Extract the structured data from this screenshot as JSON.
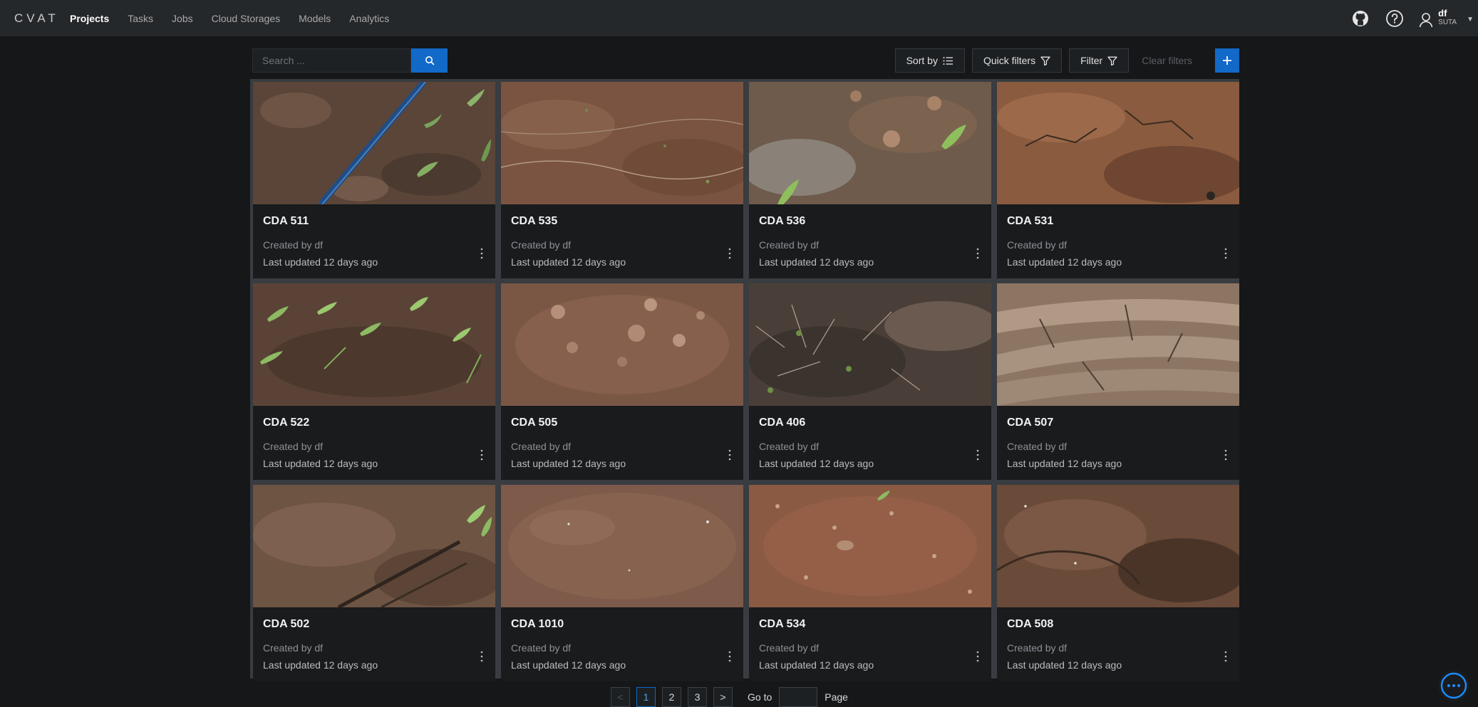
{
  "app": {
    "logo": "CVAT"
  },
  "nav": [
    {
      "label": "Projects",
      "active": true
    },
    {
      "label": "Tasks"
    },
    {
      "label": "Jobs"
    },
    {
      "label": "Cloud Storages"
    },
    {
      "label": "Models"
    },
    {
      "label": "Analytics"
    }
  ],
  "header_icons": [
    "github-icon",
    "help-icon",
    "user-icon"
  ],
  "user": {
    "name": "df",
    "org": "SUTA"
  },
  "search": {
    "placeholder": "Search ..."
  },
  "toolbar": {
    "sort_label": "Sort by",
    "quick_filters_label": "Quick filters",
    "filter_label": "Filter",
    "clear_label": "Clear filters",
    "add_label": "+"
  },
  "projects": [
    {
      "title": "CDA 511",
      "creator": "Created by df",
      "updated": "Last updated 12 days ago"
    },
    {
      "title": "CDA 535",
      "creator": "Created by df",
      "updated": "Last updated 12 days ago"
    },
    {
      "title": "CDA 536",
      "creator": "Created by df",
      "updated": "Last updated 12 days ago"
    },
    {
      "title": "CDA 531",
      "creator": "Created by df",
      "updated": "Last updated 12 days ago"
    },
    {
      "title": "CDA 522",
      "creator": "Created by df",
      "updated": "Last updated 12 days ago"
    },
    {
      "title": "CDA 505",
      "creator": "Created by df",
      "updated": "Last updated 12 days ago"
    },
    {
      "title": "CDA 406",
      "creator": "Created by df",
      "updated": "Last updated 12 days ago"
    },
    {
      "title": "CDA 507",
      "creator": "Created by df",
      "updated": "Last updated 12 days ago"
    },
    {
      "title": "CDA 502",
      "creator": "Created by df",
      "updated": "Last updated 12 days ago"
    },
    {
      "title": "CDA 1010",
      "creator": "Created by df",
      "updated": "Last updated 12 days ago"
    },
    {
      "title": "CDA 534",
      "creator": "Created by df",
      "updated": "Last updated 12 days ago"
    },
    {
      "title": "CDA 508",
      "creator": "Created by df",
      "updated": "Last updated 12 days ago"
    }
  ],
  "pagination": {
    "prev": "<",
    "next": ">",
    "pages": [
      "1",
      "2",
      "3"
    ],
    "current": "1",
    "goto_label": "Go to",
    "page_label": "Page"
  },
  "colors": {
    "accent": "#1269c8",
    "background": "#151719",
    "topbar": "#25282b",
    "card": "#191b1d"
  }
}
